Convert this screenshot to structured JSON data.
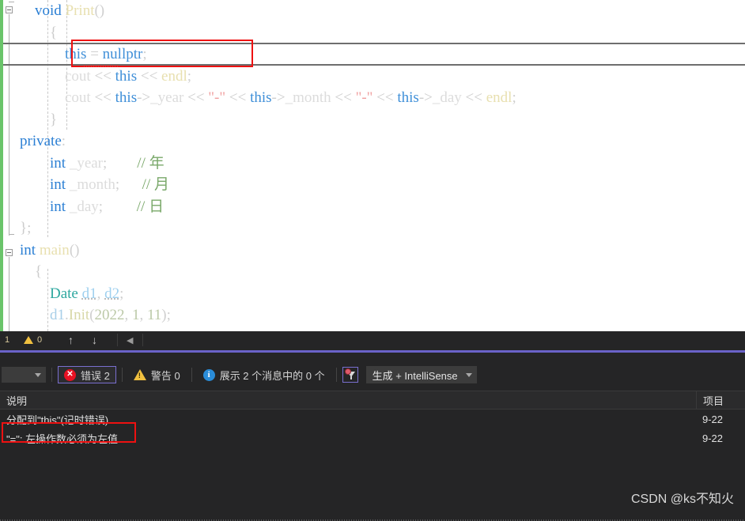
{
  "editor": {
    "lines": [
      {
        "indent": 2,
        "tokens": [
          {
            "t": "void ",
            "c": "kw"
          },
          {
            "t": "Print",
            "c": "fn"
          },
          {
            "t": "()",
            "c": "punc"
          }
        ]
      },
      {
        "indent": 3,
        "tokens": [
          {
            "t": "{",
            "c": "brace"
          }
        ]
      },
      {
        "indent": 4,
        "tokens": [
          {
            "t": "this",
            "c": "kw2"
          },
          {
            "t": " = ",
            "c": "punc"
          },
          {
            "t": "nullptr",
            "c": "kw2"
          },
          {
            "t": ";",
            "c": "punc"
          }
        ]
      },
      {
        "indent": 4,
        "tokens": [
          {
            "t": "cout",
            "c": "dim"
          },
          {
            "t": " << ",
            "c": "plain"
          },
          {
            "t": "this",
            "c": "kw2"
          },
          {
            "t": " << ",
            "c": "plain"
          },
          {
            "t": "endl",
            "c": "fn"
          },
          {
            "t": ";",
            "c": "punc"
          }
        ]
      },
      {
        "indent": 4,
        "tokens": [
          {
            "t": "cout",
            "c": "dim"
          },
          {
            "t": " << ",
            "c": "plain"
          },
          {
            "t": "this",
            "c": "kw2"
          },
          {
            "t": "->",
            "c": "plain"
          },
          {
            "t": "_year",
            "c": "dim"
          },
          {
            "t": " << ",
            "c": "plain"
          },
          {
            "t": "\"-\"",
            "c": "str"
          },
          {
            "t": " << ",
            "c": "plain"
          },
          {
            "t": "this",
            "c": "kw2"
          },
          {
            "t": "->",
            "c": "plain"
          },
          {
            "t": "_month",
            "c": "dim"
          },
          {
            "t": " << ",
            "c": "plain"
          },
          {
            "t": "\"-\"",
            "c": "str"
          },
          {
            "t": " << ",
            "c": "plain"
          },
          {
            "t": "this",
            "c": "kw2"
          },
          {
            "t": "->",
            "c": "plain"
          },
          {
            "t": "_day",
            "c": "dim"
          },
          {
            "t": " << ",
            "c": "plain"
          },
          {
            "t": "endl",
            "c": "fn"
          },
          {
            "t": ";",
            "c": "punc"
          }
        ]
      },
      {
        "indent": 3,
        "tokens": [
          {
            "t": "}",
            "c": "brace"
          }
        ]
      },
      {
        "indent": 1,
        "tokens": [
          {
            "t": "private",
            "c": "kw"
          },
          {
            "t": ":",
            "c": "punc"
          }
        ]
      },
      {
        "indent": 3,
        "tokens": [
          {
            "t": "int ",
            "c": "kw"
          },
          {
            "t": "_year",
            "c": "dim"
          },
          {
            "t": ";",
            "c": "punc"
          },
          {
            "t": "        ",
            "c": "plain"
          },
          {
            "t": "// 年",
            "c": "cmt"
          }
        ]
      },
      {
        "indent": 3,
        "tokens": [
          {
            "t": "int ",
            "c": "kw"
          },
          {
            "t": "_month",
            "c": "dim"
          },
          {
            "t": ";",
            "c": "punc"
          },
          {
            "t": "      ",
            "c": "plain"
          },
          {
            "t": "// 月",
            "c": "cmt"
          }
        ]
      },
      {
        "indent": 3,
        "tokens": [
          {
            "t": "int ",
            "c": "kw"
          },
          {
            "t": "_day",
            "c": "dim"
          },
          {
            "t": ";",
            "c": "punc"
          },
          {
            "t": "         ",
            "c": "plain"
          },
          {
            "t": "// 日",
            "c": "cmt"
          }
        ]
      },
      {
        "indent": 1,
        "tokens": [
          {
            "t": "};",
            "c": "brace"
          }
        ]
      },
      {
        "indent": 1,
        "tokens": [
          {
            "t": "int ",
            "c": "kw"
          },
          {
            "t": "main",
            "c": "fn"
          },
          {
            "t": "()",
            "c": "punc"
          }
        ]
      },
      {
        "indent": 2,
        "tokens": [
          {
            "t": "{",
            "c": "brace"
          }
        ]
      },
      {
        "indent": 3,
        "tokens": [
          {
            "t": "Date ",
            "c": "type"
          },
          {
            "t": "d1",
            "c": "var uline"
          },
          {
            "t": ", ",
            "c": "punc"
          },
          {
            "t": "d2",
            "c": "var uline"
          },
          {
            "t": ";",
            "c": "punc"
          }
        ]
      },
      {
        "indent": 3,
        "tokens": [
          {
            "t": "d1",
            "c": "var2"
          },
          {
            "t": ".",
            "c": "punc"
          },
          {
            "t": "Init",
            "c": "fn2"
          },
          {
            "t": "(",
            "c": "punc"
          },
          {
            "t": "2022",
            "c": "num"
          },
          {
            "t": ", ",
            "c": "punc"
          },
          {
            "t": "1",
            "c": "num"
          },
          {
            "t": ", ",
            "c": "punc"
          },
          {
            "t": "11",
            "c": "num"
          },
          {
            "t": ")",
            "c": "punc"
          },
          {
            "t": ";",
            "c": "punc"
          }
        ]
      }
    ],
    "highlight_line_index": 2,
    "annotation_color": "#ee1111",
    "change_bar_color": "#6ac46a"
  },
  "editor_status": {
    "line_count": "1",
    "warning_count": "0",
    "up_arrow": "↑",
    "down_arrow": "↓",
    "left_caret": "◀"
  },
  "error_list": {
    "filter_combo_value": "",
    "errors": {
      "label": "错误 2",
      "icon": "error-circle-icon"
    },
    "warnings": {
      "label": "警告 0",
      "icon": "warning-triangle-icon"
    },
    "messages": {
      "label": "展示 2 个消息中的 0 个",
      "icon": "info-circle-icon"
    },
    "filter_icon_name": "filter-funnel-icon",
    "build_scope": "生成 + IntelliSense",
    "columns": {
      "description": "说明",
      "project": "项目"
    },
    "rows": [
      {
        "description": "分配到\"this\"(记时错误)",
        "project": "9-22",
        "boxed": false
      },
      {
        "description": "\"=\": 左操作数必须为左值",
        "project": "9-22",
        "boxed": true
      }
    ],
    "separator_color": "#6a62c8"
  },
  "watermark": {
    "text": "CSDN @ks不知火"
  }
}
